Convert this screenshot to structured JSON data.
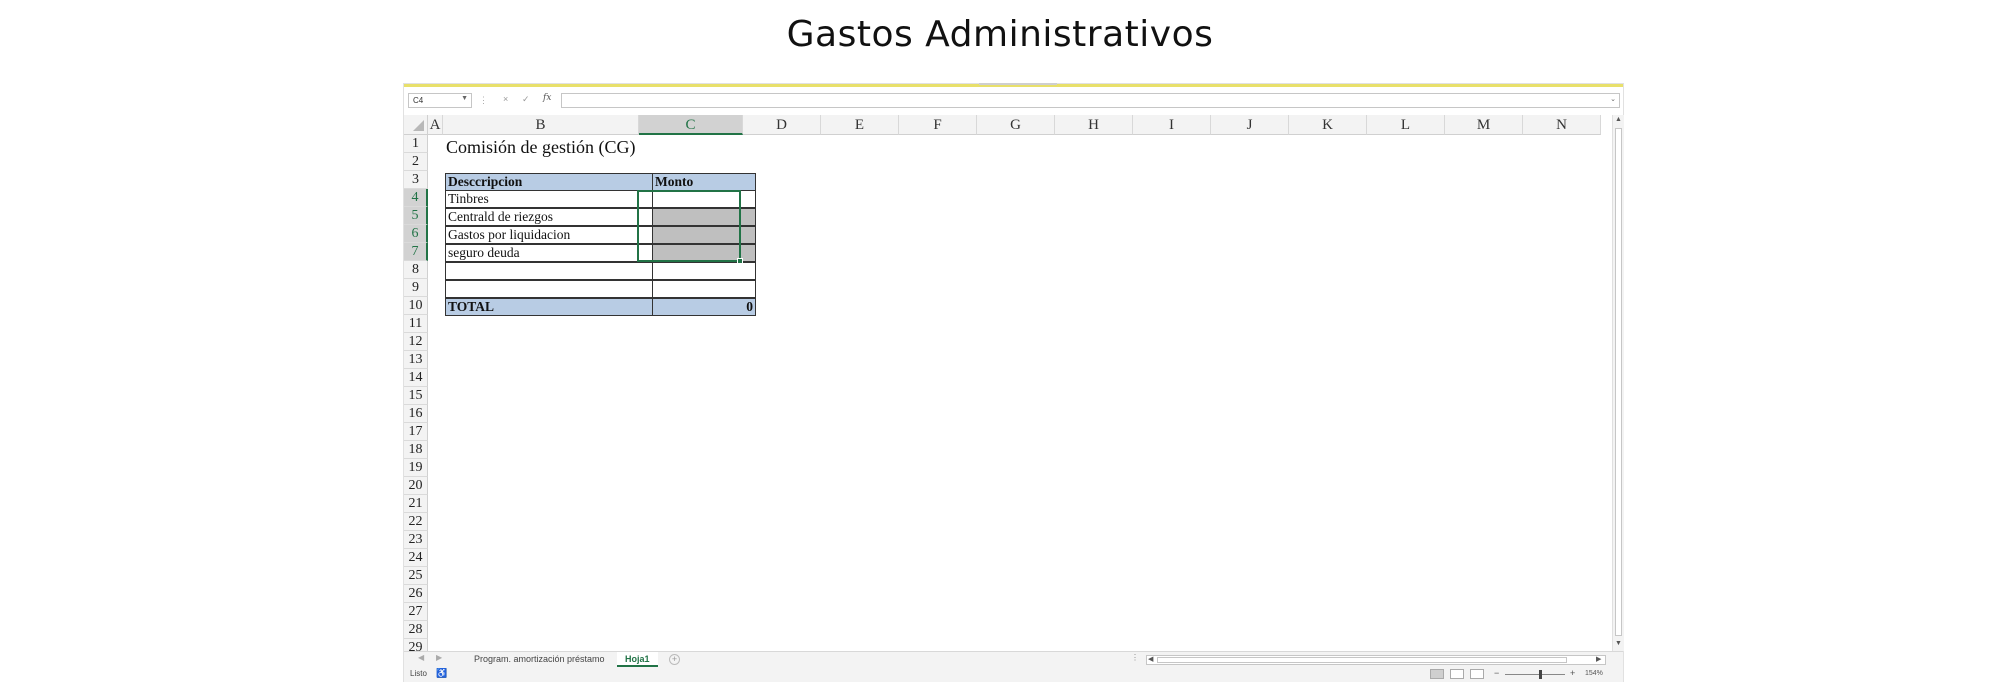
{
  "slide": {
    "title": "Gastos Administrativos"
  },
  "formula_bar": {
    "name_box": "C4",
    "cancel_icon": "×",
    "enter_icon": "✓",
    "fx_label": "fx",
    "formula": ""
  },
  "columns": [
    "A",
    "B",
    "C",
    "D",
    "E",
    "F",
    "G",
    "H",
    "I",
    "J",
    "K",
    "L",
    "M",
    "N"
  ],
  "selected_column": "C",
  "rows": [
    "1",
    "2",
    "3",
    "4",
    "5",
    "6",
    "7",
    "8",
    "9",
    "10",
    "11",
    "12",
    "13",
    "14",
    "15",
    "16",
    "17",
    "18",
    "19",
    "20",
    "21",
    "22",
    "23",
    "24",
    "25",
    "26",
    "27",
    "28",
    "29"
  ],
  "selected_rows": [
    "4",
    "5",
    "6",
    "7"
  ],
  "sheet": {
    "title": "Comisión de gestión (CG)",
    "table": {
      "header": {
        "desc": "Desccripcion",
        "amount": "Monto"
      },
      "rows": [
        {
          "desc": "Tinbres",
          "amount": ""
        },
        {
          "desc": "Centrald de riezgos",
          "amount": ""
        },
        {
          "desc": "Gastos por liquidacion",
          "amount": ""
        },
        {
          "desc": "seguro deuda",
          "amount": ""
        },
        {
          "desc": "",
          "amount": ""
        },
        {
          "desc": "",
          "amount": ""
        }
      ],
      "total": {
        "desc": "TOTAL",
        "amount": "0"
      }
    }
  },
  "sheet_tabs": [
    {
      "label": "Program. amortización préstamo",
      "active": false
    },
    {
      "label": "Hoja1",
      "active": true
    }
  ],
  "status_bar": {
    "ready": "Listo",
    "zoom": "154%"
  },
  "colors": {
    "excel_green": "#217346",
    "table_header_fill": "#b8cce4",
    "input_gray_fill": "#bfbfbf"
  }
}
